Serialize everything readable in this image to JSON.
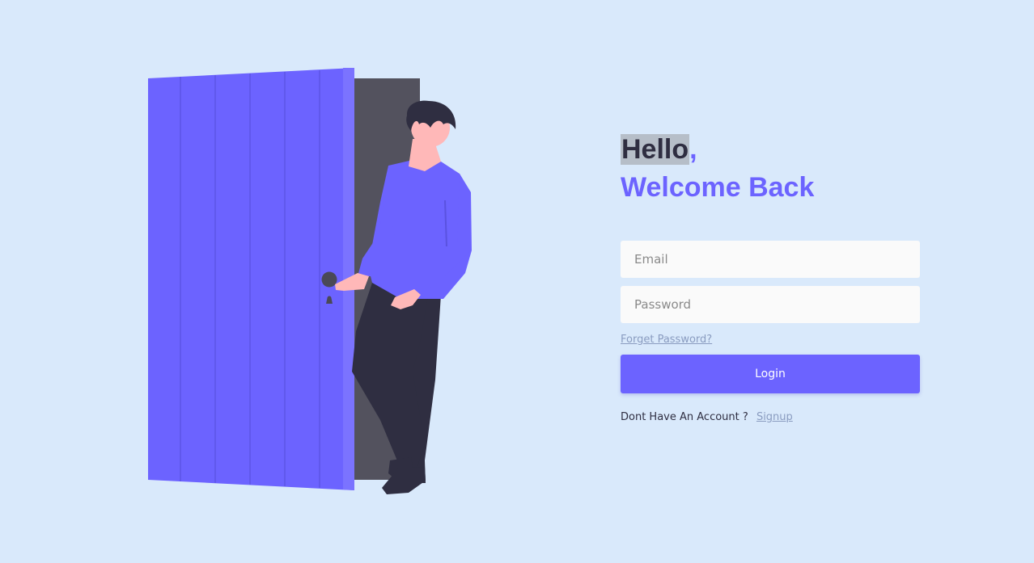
{
  "colors": {
    "background": "#d9e9fb",
    "accent": "#6c63ff",
    "dark": "#2f2e41",
    "input_bg": "#fafafa",
    "link": "#8a9cc0"
  },
  "illustration": {
    "icon": "person-opening-door-illustration"
  },
  "greeting": {
    "hello": "Hello",
    "comma": ",",
    "welcome": "Welcome Back"
  },
  "form": {
    "email_placeholder": "Email",
    "email_value": "",
    "password_placeholder": "Password",
    "password_value": "",
    "forgot_label": "Forget Password?",
    "login_label": "Login",
    "signup_prompt": "Dont Have An Account ?",
    "signup_label": "Signup"
  }
}
